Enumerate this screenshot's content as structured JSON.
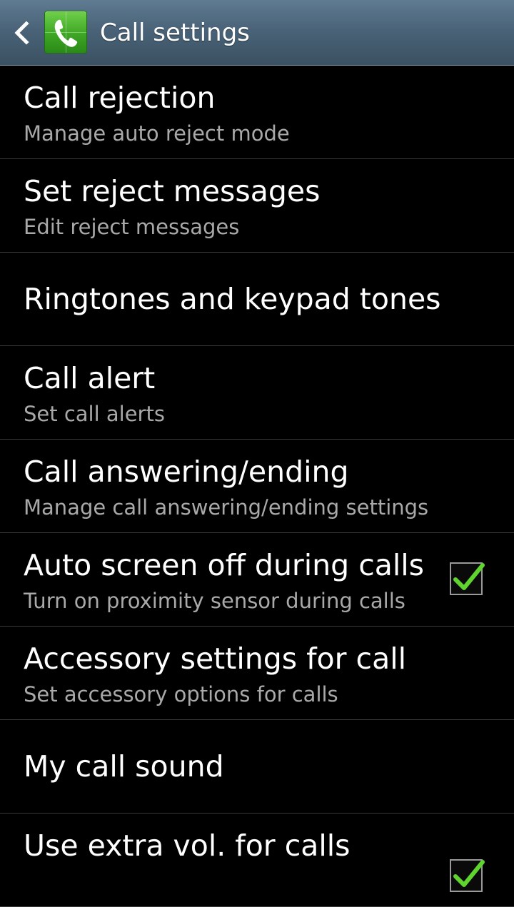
{
  "header": {
    "title": "Call settings",
    "back_icon": "back-chevron-icon",
    "app_icon": "phone-handset-icon",
    "accent_color": "#3ea625"
  },
  "items": [
    {
      "title": "Call rejection",
      "subtitle": "Manage auto reject mode"
    },
    {
      "title": "Set reject messages",
      "subtitle": "Edit reject messages"
    },
    {
      "title": "Ringtones and keypad tones"
    },
    {
      "title": "Call alert",
      "subtitle": "Set call alerts"
    },
    {
      "title": "Call answering/ending",
      "subtitle": "Manage call answering/ending settings"
    },
    {
      "title": "Auto screen off during calls",
      "subtitle": "Turn on proximity sensor during calls",
      "checked": true
    },
    {
      "title": "Accessory settings for call",
      "subtitle": "Set accessory options for calls"
    },
    {
      "title": "My call sound"
    },
    {
      "title": "Use extra vol. for calls",
      "checked": true
    }
  ]
}
